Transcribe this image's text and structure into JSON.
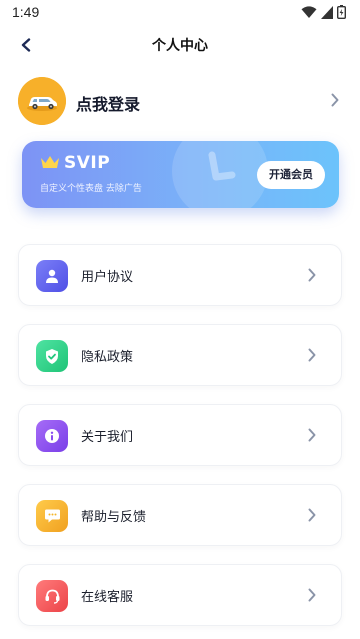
{
  "status_bar": {
    "time": "1:49",
    "icons": [
      "wifi-icon",
      "signal-icon",
      "battery-icon"
    ]
  },
  "nav": {
    "title": "个人中心",
    "back_icon": "back-arrow-icon"
  },
  "profile": {
    "login_label": "点我登录",
    "avatar_icon": "car-avatar-icon",
    "avatar_color": "#f7b02a"
  },
  "vip": {
    "title": "SVIP",
    "subtitle": "自定义个性表盘  去除广告",
    "button_label": "开通会员",
    "crown_color": "#ffd54a"
  },
  "menu": {
    "items": [
      {
        "label": "用户协议",
        "icon": "user-icon",
        "color": "#5b5ff0"
      },
      {
        "label": "隐私政策",
        "icon": "shield-check-icon",
        "color": "#2fd28a"
      },
      {
        "label": "关于我们",
        "icon": "info-icon",
        "color": "#8a4cf0"
      },
      {
        "label": "帮助与反馈",
        "icon": "chat-bubble-icon",
        "color": "#f5b52a"
      },
      {
        "label": "在线客服",
        "icon": "headset-icon",
        "color": "#f2585a"
      }
    ]
  }
}
